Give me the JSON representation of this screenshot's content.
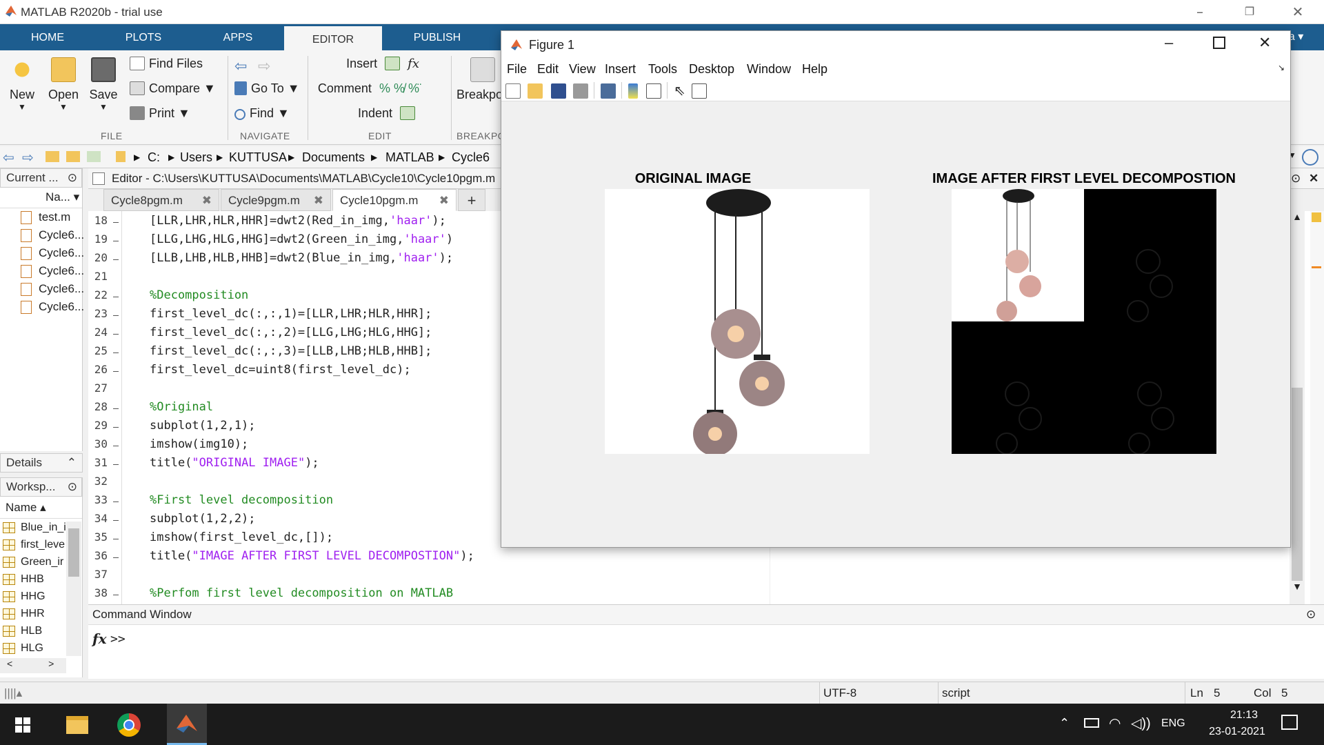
{
  "app": {
    "title": "MATLAB R2020b - trial use"
  },
  "toolstrip_tabs": [
    "HOME",
    "PLOTS",
    "APPS",
    "EDITOR",
    "PUBLISH"
  ],
  "ribbon": {
    "file": {
      "new": "New",
      "open": "Open",
      "save": "Save",
      "find_files": "Find Files",
      "compare": "Compare",
      "print": "Print",
      "section": "FILE"
    },
    "navigate": {
      "go_to": "Go To",
      "find": "Find",
      "section": "NAVIGATE"
    },
    "edit": {
      "insert": "Insert",
      "comment": "Comment",
      "indent": "Indent",
      "section": "EDIT"
    },
    "breakpoints": {
      "label": "Breakpo",
      "section": "BREAKPO"
    }
  },
  "address": {
    "crumbs": [
      "C:",
      "Users",
      "KUTTUSA",
      "Documents",
      "MATLAB",
      "Cycle6"
    ]
  },
  "current_folder": {
    "header": "Current ...",
    "column": "Na...",
    "files": [
      "test.m",
      "Cycle6...",
      "Cycle6...",
      "Cycle6...",
      "Cycle6...",
      "Cycle6..."
    ]
  },
  "details_header": "Details",
  "workspace": {
    "header": "Worksp...",
    "column": "Name",
    "vars": [
      "Blue_in_i",
      "first_leve",
      "Green_ir",
      "HHB",
      "HHG",
      "HHR",
      "HLB",
      "HLG"
    ]
  },
  "editor": {
    "title": "Editor - C:\\Users\\KUTTUSA\\Documents\\MATLAB\\Cycle10\\Cycle10pgm.m",
    "tabs": [
      "Cycle8pgm.m",
      "Cycle9pgm.m",
      "Cycle10pgm.m"
    ],
    "lines": [
      {
        "n": "18",
        "pre": "[LLR,LHR,HLR,HHR]=dwt2(Red_in_img,",
        "str": "'haar'",
        "post": ");",
        "cls": ""
      },
      {
        "n": "19",
        "pre": "[LLG,LHG,HLG,HHG]=dwt2(Green_in_img,",
        "str": "'haar'",
        "post": ")",
        "cls": ""
      },
      {
        "n": "20",
        "pre": "[LLB,LHB,HLB,HHB]=dwt2(Blue_in_img,",
        "str": "'haar'",
        "post": ");",
        "cls": ""
      },
      {
        "n": "21",
        "pre": "",
        "str": "",
        "post": "",
        "cls": ""
      },
      {
        "n": "22",
        "pre": "%Decomposition",
        "str": "",
        "post": "",
        "cls": "cm"
      },
      {
        "n": "23",
        "pre": "first_level_dc(:,:,1)=[LLR,LHR;HLR,HHR];",
        "str": "",
        "post": "",
        "cls": ""
      },
      {
        "n": "24",
        "pre": "first_level_dc(:,:,2)=[LLG,LHG;HLG,HHG];",
        "str": "",
        "post": "",
        "cls": ""
      },
      {
        "n": "25",
        "pre": "first_level_dc(:,:,3)=[LLB,LHB;HLB,HHB];",
        "str": "",
        "post": "",
        "cls": ""
      },
      {
        "n": "26",
        "pre": "first_level_dc=uint8(first_level_dc);",
        "str": "",
        "post": "",
        "cls": ""
      },
      {
        "n": "27",
        "pre": "",
        "str": "",
        "post": "",
        "cls": ""
      },
      {
        "n": "28",
        "pre": "%Original",
        "str": "",
        "post": "",
        "cls": "cm"
      },
      {
        "n": "29",
        "pre": "subplot(1,2,1);",
        "str": "",
        "post": "",
        "cls": ""
      },
      {
        "n": "30",
        "pre": "imshow(img10);",
        "str": "",
        "post": "",
        "cls": ""
      },
      {
        "n": "31",
        "pre": "title(",
        "str": "\"ORIGINAL IMAGE\"",
        "post": ");",
        "cls": ""
      },
      {
        "n": "32",
        "pre": "",
        "str": "",
        "post": "",
        "cls": ""
      },
      {
        "n": "33",
        "pre": "%First level decomposition",
        "str": "",
        "post": "",
        "cls": "cm"
      },
      {
        "n": "34",
        "pre": "subplot(1,2,2);",
        "str": "",
        "post": "",
        "cls": ""
      },
      {
        "n": "35",
        "pre": "imshow(first_level_dc,[]);",
        "str": "",
        "post": "",
        "cls": ""
      },
      {
        "n": "36",
        "pre": "title(",
        "str": "\"IMAGE AFTER FIRST LEVEL DECOMPOSTION\"",
        "post": ");",
        "cls": ""
      },
      {
        "n": "37",
        "pre": "",
        "str": "",
        "post": "",
        "cls": ""
      },
      {
        "n": "38",
        "pre": "%Perfom first level decomposition on MATLAB",
        "str": "",
        "post": "",
        "cls": "cm"
      }
    ]
  },
  "command_window": {
    "header": "Command Window",
    "prompt": ">>"
  },
  "figure": {
    "title": "Figure 1",
    "menu": [
      "File",
      "Edit",
      "View",
      "Insert",
      "Tools",
      "Desktop",
      "Window",
      "Help"
    ],
    "axes_left_title": "ORIGINAL IMAGE",
    "axes_right_title": "IMAGE AFTER FIRST LEVEL DECOMPOSTION"
  },
  "statusbar": {
    "encoding": "UTF-8",
    "type": "script",
    "ln_label": "Ln",
    "ln": "5",
    "col_label": "Col",
    "col": "5"
  },
  "taskbar": {
    "lang": "ENG",
    "time": "21:13",
    "date": "23-01-2021"
  },
  "colors": {
    "accent": "#1d5d8f",
    "taskbar": "#1b1b1b",
    "string": "#a020f0",
    "comment": "#228b22"
  }
}
